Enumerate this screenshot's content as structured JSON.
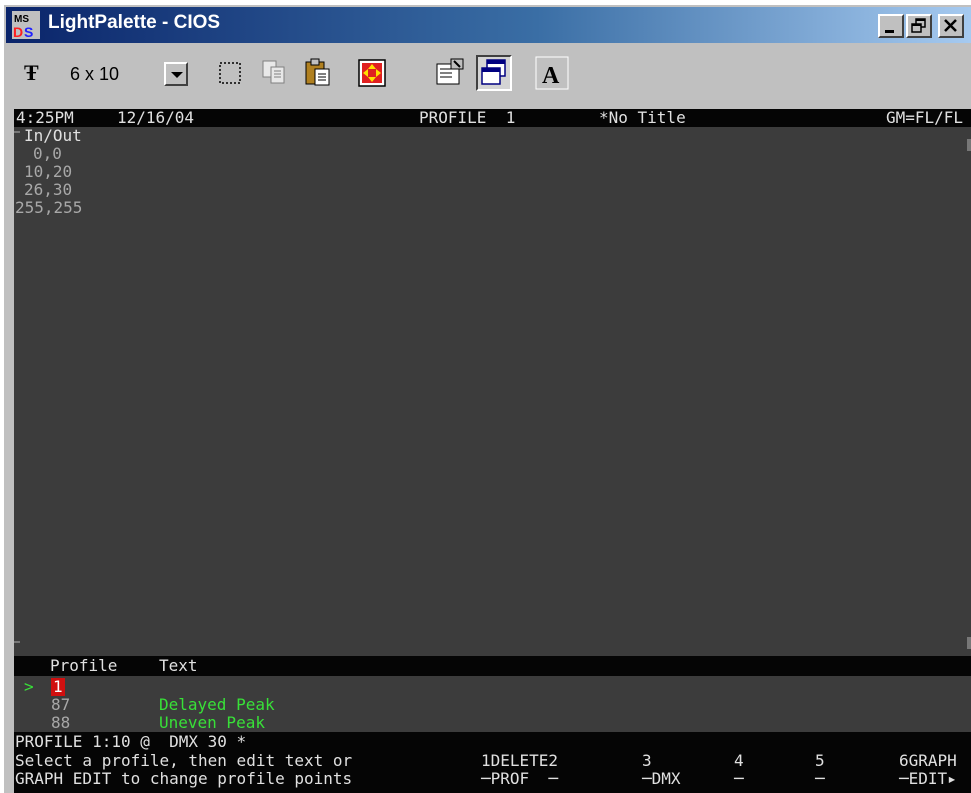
{
  "window": {
    "title": "LightPalette - CIOS",
    "icon_label": "MS"
  },
  "toolbar": {
    "font_size": "6 x 10"
  },
  "terminal": {
    "header": {
      "time": "4:25PM",
      "date": "12/16/04",
      "mode": "PROFILE  1",
      "title": "*No Title",
      "status": "GM=FL/FL"
    },
    "points_header": "In/Out",
    "points": [
      "0,0",
      "10,20",
      "26,30",
      "255,255"
    ],
    "list_header": {
      "profile": "Profile",
      "text": "Text"
    },
    "list_rows": [
      {
        "marker": ">",
        "id": "1",
        "text": ""
      },
      {
        "marker": "",
        "id": "87",
        "text": "Delayed Peak"
      },
      {
        "marker": "",
        "id": "88",
        "text": "Uneven Peak"
      }
    ],
    "command_line": "PROFILE 1:10 @  DMX 30 *",
    "prompt_line1": "Select a profile, then edit text or",
    "prompt_line2": "GRAPH EDIT to change profile points",
    "softkeys_top": [
      "1DELETE2",
      "3",
      "4",
      "5",
      "6GRAPH"
    ],
    "softkeys_bottom": [
      "─PROF  ─",
      "─DMX",
      "─",
      "─",
      "─EDIT▸"
    ]
  }
}
